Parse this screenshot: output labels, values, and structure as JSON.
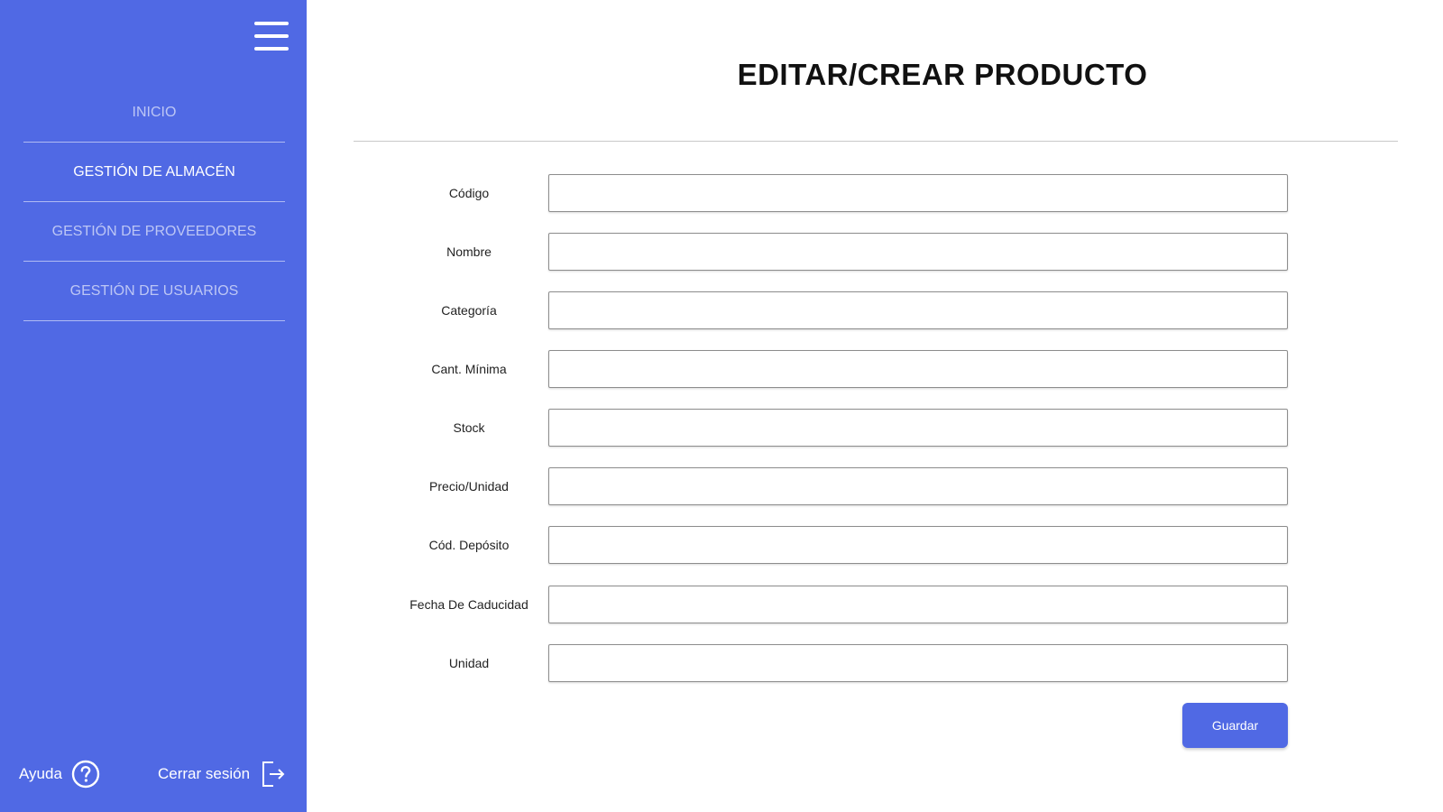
{
  "sidebar": {
    "menu_icon": "hamburger-menu-icon",
    "items": [
      {
        "label": "INICIO",
        "active": false
      },
      {
        "label": "GESTIÓN DE ALMACÉN",
        "active": true
      },
      {
        "label": "GESTIÓN DE PROVEEDORES",
        "active": false
      },
      {
        "label": "GESTIÓN DE USUARIOS",
        "active": false
      }
    ],
    "footer": {
      "help_label": "Ayuda",
      "help_icon": "question-circle-icon",
      "logout_label": "Cerrar sesión",
      "logout_icon": "logout-icon"
    }
  },
  "main": {
    "title": "EDITAR/CREAR PRODUCTO",
    "fields": [
      {
        "label": "Código",
        "value": ""
      },
      {
        "label": "Nombre",
        "value": ""
      },
      {
        "label": "Categoría",
        "value": ""
      },
      {
        "label": "Cant. Mínima",
        "value": ""
      },
      {
        "label": "Stock",
        "value": ""
      },
      {
        "label": "Precio/Unidad",
        "value": ""
      },
      {
        "label": "Cód. Depósito",
        "value": ""
      },
      {
        "label": "Fecha De Caducidad",
        "value": ""
      },
      {
        "label": "Unidad",
        "value": ""
      }
    ],
    "save_label": "Guardar"
  },
  "colors": {
    "sidebar_bg": "#5069e4",
    "accent": "#5069e4",
    "text": "#111111"
  }
}
